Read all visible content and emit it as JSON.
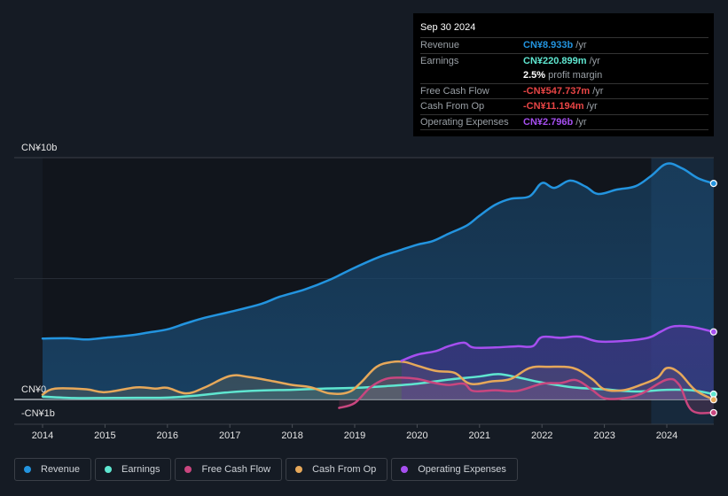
{
  "tooltip": {
    "date": "Sep 30 2024",
    "rows": [
      {
        "label": "Revenue",
        "value": "CN¥8.933b",
        "unit": "/yr",
        "color": "#2394df"
      },
      {
        "label": "Earnings",
        "value": "CN¥220.899m",
        "unit": "/yr",
        "color": "#5fe6d0"
      },
      {
        "label": "",
        "value": "2.5%",
        "unit": "profit margin",
        "color": "#ffffff"
      },
      {
        "label": "Free Cash Flow",
        "value": "-CN¥547.737m",
        "unit": "/yr",
        "color": "#e84545"
      },
      {
        "label": "Cash From Op",
        "value": "-CN¥11.194m",
        "unit": "/yr",
        "color": "#e84545"
      },
      {
        "label": "Operating Expenses",
        "value": "CN¥2.796b",
        "unit": "/yr",
        "color": "#a64ff0"
      }
    ]
  },
  "legend": [
    {
      "label": "Revenue",
      "color": "#2394df"
    },
    {
      "label": "Earnings",
      "color": "#5fe6d0"
    },
    {
      "label": "Free Cash Flow",
      "color": "#c9467f"
    },
    {
      "label": "Cash From Op",
      "color": "#e6a85a"
    },
    {
      "label": "Operating Expenses",
      "color": "#a64ff0"
    }
  ],
  "chart_data": {
    "type": "area",
    "title": "",
    "xlabel": "",
    "ylabel": "",
    "unit": "CN¥ billions",
    "y_tick_labels": [
      {
        "value": 10,
        "label": "CN¥10b"
      },
      {
        "value": 0,
        "label": "CN¥0"
      },
      {
        "value": -1,
        "label": "-CN¥1b"
      }
    ],
    "ylim": [
      -1,
      10
    ],
    "xlim": [
      2014,
      2024.75
    ],
    "x_ticks": [
      2014,
      2015,
      2016,
      2017,
      2018,
      2019,
      2020,
      2021,
      2022,
      2023,
      2024
    ],
    "x_tick_labels": [
      "2014",
      "2015",
      "2016",
      "2017",
      "2018",
      "2019",
      "2020",
      "2021",
      "2022",
      "2023",
      "2024"
    ],
    "highlight_start": 2023.75,
    "grid": true,
    "legend_position": "bottom",
    "series": [
      {
        "name": "Revenue",
        "color": "#2394df",
        "points": [
          [
            2014,
            2.52
          ],
          [
            2014.4,
            2.53
          ],
          [
            2014.7,
            2.48
          ],
          [
            2015,
            2.55
          ],
          [
            2015.4,
            2.65
          ],
          [
            2015.7,
            2.77
          ],
          [
            2016,
            2.9
          ],
          [
            2016.3,
            3.15
          ],
          [
            2016.6,
            3.38
          ],
          [
            2017,
            3.62
          ],
          [
            2017.5,
            3.95
          ],
          [
            2017.8,
            4.25
          ],
          [
            2018.2,
            4.55
          ],
          [
            2018.6,
            4.95
          ],
          [
            2019,
            5.45
          ],
          [
            2019.4,
            5.9
          ],
          [
            2019.7,
            6.15
          ],
          [
            2020,
            6.4
          ],
          [
            2020.25,
            6.55
          ],
          [
            2020.5,
            6.85
          ],
          [
            2020.8,
            7.2
          ],
          [
            2021,
            7.6
          ],
          [
            2021.25,
            8.05
          ],
          [
            2021.5,
            8.3
          ],
          [
            2021.8,
            8.4
          ],
          [
            2022,
            8.95
          ],
          [
            2022.2,
            8.75
          ],
          [
            2022.45,
            9.05
          ],
          [
            2022.7,
            8.8
          ],
          [
            2022.9,
            8.5
          ],
          [
            2023.2,
            8.68
          ],
          [
            2023.5,
            8.82
          ],
          [
            2023.75,
            9.25
          ],
          [
            2024,
            9.75
          ],
          [
            2024.25,
            9.55
          ],
          [
            2024.5,
            9.15
          ],
          [
            2024.75,
            8.933
          ]
        ]
      },
      {
        "name": "Earnings",
        "color": "#5fe6d0",
        "points": [
          [
            2014,
            0.12
          ],
          [
            2014.5,
            0.06
          ],
          [
            2015,
            0.06
          ],
          [
            2015.5,
            0.07
          ],
          [
            2016,
            0.08
          ],
          [
            2016.5,
            0.17
          ],
          [
            2017,
            0.3
          ],
          [
            2017.5,
            0.37
          ],
          [
            2018,
            0.4
          ],
          [
            2018.5,
            0.45
          ],
          [
            2019,
            0.48
          ],
          [
            2019.5,
            0.55
          ],
          [
            2020,
            0.65
          ],
          [
            2020.5,
            0.82
          ],
          [
            2021,
            0.95
          ],
          [
            2021.3,
            1.05
          ],
          [
            2021.6,
            0.92
          ],
          [
            2022,
            0.7
          ],
          [
            2022.5,
            0.5
          ],
          [
            2023,
            0.42
          ],
          [
            2023.5,
            0.33
          ],
          [
            2024,
            0.4
          ],
          [
            2024.4,
            0.38
          ],
          [
            2024.75,
            0.22
          ]
        ]
      },
      {
        "name": "Free Cash Flow",
        "color": "#c9467f",
        "points": [
          [
            2018.75,
            -0.35
          ],
          [
            2019,
            -0.15
          ],
          [
            2019.25,
            0.5
          ],
          [
            2019.5,
            0.85
          ],
          [
            2019.75,
            0.9
          ],
          [
            2020,
            0.85
          ],
          [
            2020.25,
            0.7
          ],
          [
            2020.5,
            0.6
          ],
          [
            2020.75,
            0.65
          ],
          [
            2020.9,
            0.35
          ],
          [
            2021.25,
            0.38
          ],
          [
            2021.6,
            0.35
          ],
          [
            2022,
            0.65
          ],
          [
            2022.3,
            0.68
          ],
          [
            2022.55,
            0.8
          ],
          [
            2022.8,
            0.4
          ],
          [
            2023,
            0.05
          ],
          [
            2023.3,
            0.05
          ],
          [
            2023.6,
            0.25
          ],
          [
            2024,
            0.82
          ],
          [
            2024.2,
            0.6
          ],
          [
            2024.4,
            -0.45
          ],
          [
            2024.75,
            -0.548
          ]
        ]
      },
      {
        "name": "Cash From Op",
        "color": "#e6a85a",
        "points": [
          [
            2014,
            0.2
          ],
          [
            2014.2,
            0.45
          ],
          [
            2014.7,
            0.42
          ],
          [
            2015,
            0.3
          ],
          [
            2015.5,
            0.5
          ],
          [
            2015.8,
            0.45
          ],
          [
            2016,
            0.48
          ],
          [
            2016.3,
            0.25
          ],
          [
            2016.6,
            0.5
          ],
          [
            2017,
            0.97
          ],
          [
            2017.3,
            0.93
          ],
          [
            2017.7,
            0.75
          ],
          [
            2018,
            0.6
          ],
          [
            2018.3,
            0.5
          ],
          [
            2018.6,
            0.25
          ],
          [
            2018.9,
            0.3
          ],
          [
            2019.1,
            0.7
          ],
          [
            2019.35,
            1.35
          ],
          [
            2019.6,
            1.55
          ],
          [
            2019.8,
            1.55
          ],
          [
            2020,
            1.4
          ],
          [
            2020.3,
            1.18
          ],
          [
            2020.6,
            1.1
          ],
          [
            2020.85,
            0.65
          ],
          [
            2021.2,
            0.75
          ],
          [
            2021.5,
            0.85
          ],
          [
            2021.8,
            1.3
          ],
          [
            2022.1,
            1.35
          ],
          [
            2022.5,
            1.3
          ],
          [
            2022.8,
            0.85
          ],
          [
            2023,
            0.42
          ],
          [
            2023.3,
            0.38
          ],
          [
            2023.6,
            0.62
          ],
          [
            2023.85,
            0.9
          ],
          [
            2024,
            1.3
          ],
          [
            2024.2,
            1.1
          ],
          [
            2024.45,
            0.4
          ],
          [
            2024.75,
            -0.011
          ]
        ]
      },
      {
        "name": "Operating Expenses",
        "color": "#a64ff0",
        "points": [
          [
            2019.75,
            1.6
          ],
          [
            2020,
            1.85
          ],
          [
            2020.3,
            2.0
          ],
          [
            2020.5,
            2.2
          ],
          [
            2020.75,
            2.35
          ],
          [
            2020.9,
            2.15
          ],
          [
            2021.25,
            2.15
          ],
          [
            2021.6,
            2.2
          ],
          [
            2021.85,
            2.2
          ],
          [
            2022,
            2.58
          ],
          [
            2022.3,
            2.55
          ],
          [
            2022.6,
            2.6
          ],
          [
            2022.9,
            2.4
          ],
          [
            2023.3,
            2.42
          ],
          [
            2023.7,
            2.55
          ],
          [
            2023.9,
            2.8
          ],
          [
            2024.1,
            3.02
          ],
          [
            2024.4,
            3.0
          ],
          [
            2024.75,
            2.796
          ]
        ]
      }
    ]
  }
}
